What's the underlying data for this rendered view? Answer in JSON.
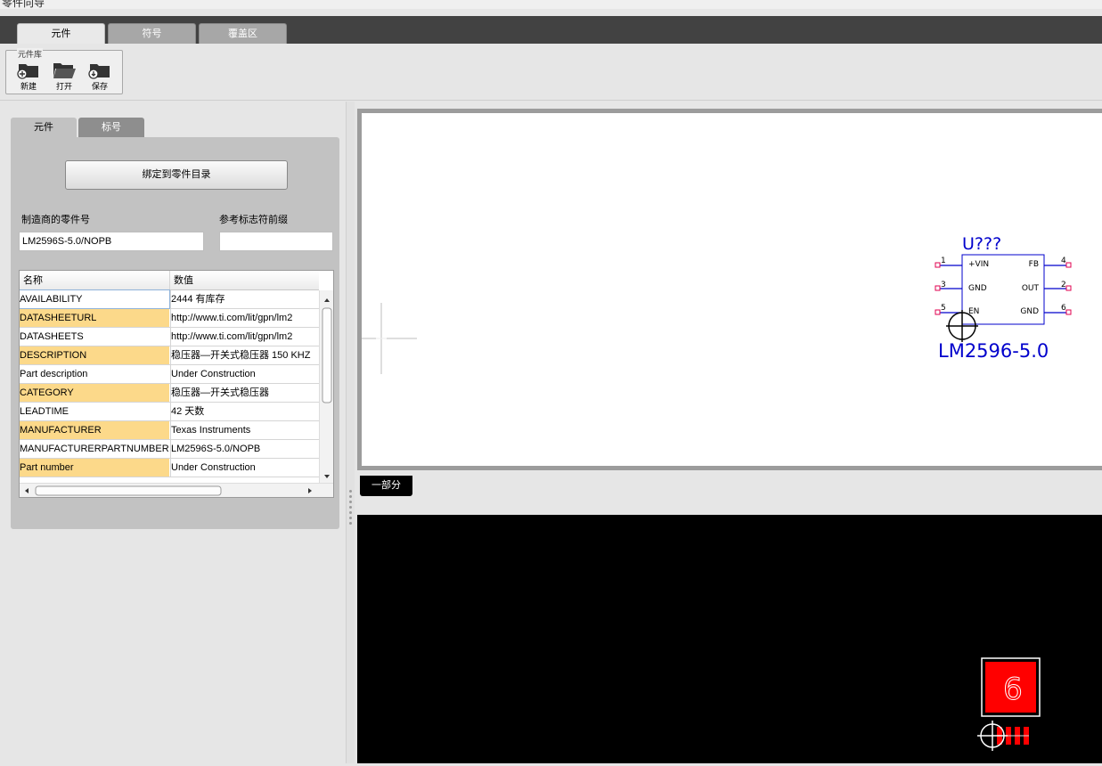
{
  "window": {
    "title": "零件向导"
  },
  "ribbon": {
    "tabs": [
      {
        "label": "元件",
        "active": true
      },
      {
        "label": "符号",
        "active": false
      },
      {
        "label": "覆盖区",
        "active": false
      }
    ],
    "library_group": {
      "title": "元件库",
      "buttons": [
        {
          "label": "新建",
          "icon": "new-folder-icon"
        },
        {
          "label": "打开",
          "icon": "open-folder-icon"
        },
        {
          "label": "保存",
          "icon": "save-folder-icon"
        }
      ]
    }
  },
  "left_panel": {
    "tabs": [
      {
        "label": "元件",
        "active": true
      },
      {
        "label": "标号",
        "active": false
      }
    ],
    "bind_button": "绑定到零件目录",
    "mfr_part_label": "制造商的零件号",
    "mfr_part_value": "LM2596S-5.0/NOPB",
    "ref_prefix_label": "参考标志符前缀",
    "ref_prefix_value": "",
    "grid": {
      "col_name": "名称",
      "col_value": "数值",
      "rows": [
        {
          "name": "AVAILABILITY",
          "value": "2444 有库存",
          "highlight": false
        },
        {
          "name": "DATASHEETURL",
          "value": "http://www.ti.com/lit/gpn/lm2",
          "highlight": true
        },
        {
          "name": "DATASHEETS",
          "value": "http://www.ti.com/lit/gpn/lm2",
          "highlight": false
        },
        {
          "name": "DESCRIPTION",
          "value": "稳压器—开关式稳压器 150 KHZ",
          "highlight": true
        },
        {
          "name": "Part description",
          "value": "Under Construction",
          "highlight": false
        },
        {
          "name": "CATEGORY",
          "value": "稳压器—开关式稳压器",
          "highlight": true
        },
        {
          "name": "LEADTIME",
          "value": "42 天数",
          "highlight": false
        },
        {
          "name": "MANUFACTURER",
          "value": "Texas Instruments",
          "highlight": true
        },
        {
          "name": "MANUFACTURERPARTNUMBER",
          "value": "LM2596S-5.0/NOPB",
          "highlight": false
        },
        {
          "name": "Part number",
          "value": "Under Construction",
          "highlight": true
        }
      ]
    }
  },
  "symbol_view": {
    "designator": "U???",
    "part_name": "LM2596-5.0",
    "pins_left": [
      {
        "num": "1",
        "name": "+VIN"
      },
      {
        "num": "3",
        "name": "GND"
      },
      {
        "num": "5",
        "name": "EN"
      }
    ],
    "pins_right": [
      {
        "num": "4",
        "name": "FB"
      },
      {
        "num": "2",
        "name": "OUT"
      },
      {
        "num": "6",
        "name": "GND"
      }
    ],
    "accent": "#0000cc"
  },
  "part_tab": "一部分",
  "footprint_view": {
    "pad_label": "6",
    "pad_color": "#ff0000"
  }
}
